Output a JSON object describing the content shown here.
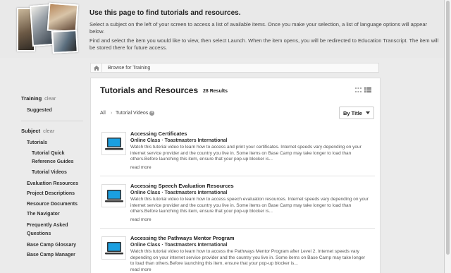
{
  "header": {
    "title": "Use this page to find tutorials and resources.",
    "text1": "Select a subject on the left of your screen to access a list of available items. Once you make your selection, a list of language options will appear below.",
    "text2": "Find and select the item you would like to view, then select Launch. When the item opens, you will be redirected to Education Transcript. The item will be stored there for future access."
  },
  "breadcrumb": {
    "label": "Browse for Training"
  },
  "sidebar": {
    "training_label": "Training",
    "clear_label": "clear",
    "suggested": "Suggested",
    "subject_label": "Subject",
    "items": [
      "Tutorials",
      "Tutorial Quick",
      "Reference Guides",
      "Tutorial Videos",
      "Evaluation Resources",
      "Project Descriptions",
      "Resource Documents",
      "The Navigator",
      "Frequently Asked",
      "Questions",
      "Base Camp Glossary",
      "Base Camp Manager"
    ]
  },
  "main": {
    "title": "Tutorials and Resources",
    "results": "28 Results",
    "filter_all": "All",
    "filter_chip": "Tutorial Videos",
    "sort_label": "By Title",
    "read_more": "read more",
    "items": [
      {
        "title": "Accessing Certificates",
        "type": "Online Class",
        "provider": "Toastmasters International",
        "desc": "Watch this tutorial video to learn how to access and print your certificates. Internet speeds vary depending on your internet service provider and the country you live in. Some items on Base Camp may take longer to load than others.Before launching this item, ensure that your pop-up blocker is..."
      },
      {
        "title": "Accessing Speech Evaluation Resources",
        "type": "Online Class",
        "provider": "Toastmasters International",
        "desc": "Watch this tutorial video to learn how to access speech evaluation resources. Internet speeds vary depending on your internet service provider and the country you live in. Some items on Base Camp may take longer to load than others.Before launching this item, ensure that your pop-up blocker is..."
      },
      {
        "title": "Accessing the Pathways Mentor Program",
        "type": "Online Class",
        "provider": "Toastmasters International",
        "desc": "Watch this tutorial video to learn how to access the Pathways Mentor Program after Level 2. Internet speeds vary depending on your internet service provider and the country you live in. Some items on Base Camp may take longer to load than others.Before launching this item, ensure that your pop-up blocker is..."
      }
    ]
  },
  "colors": {
    "accent": "#1a9fe0",
    "background": "#ebebeb"
  },
  "icons": [
    "home-icon",
    "grid-view-icon",
    "list-view-icon",
    "laptop-icon",
    "caret-down-icon",
    "remove-filter-icon"
  ]
}
